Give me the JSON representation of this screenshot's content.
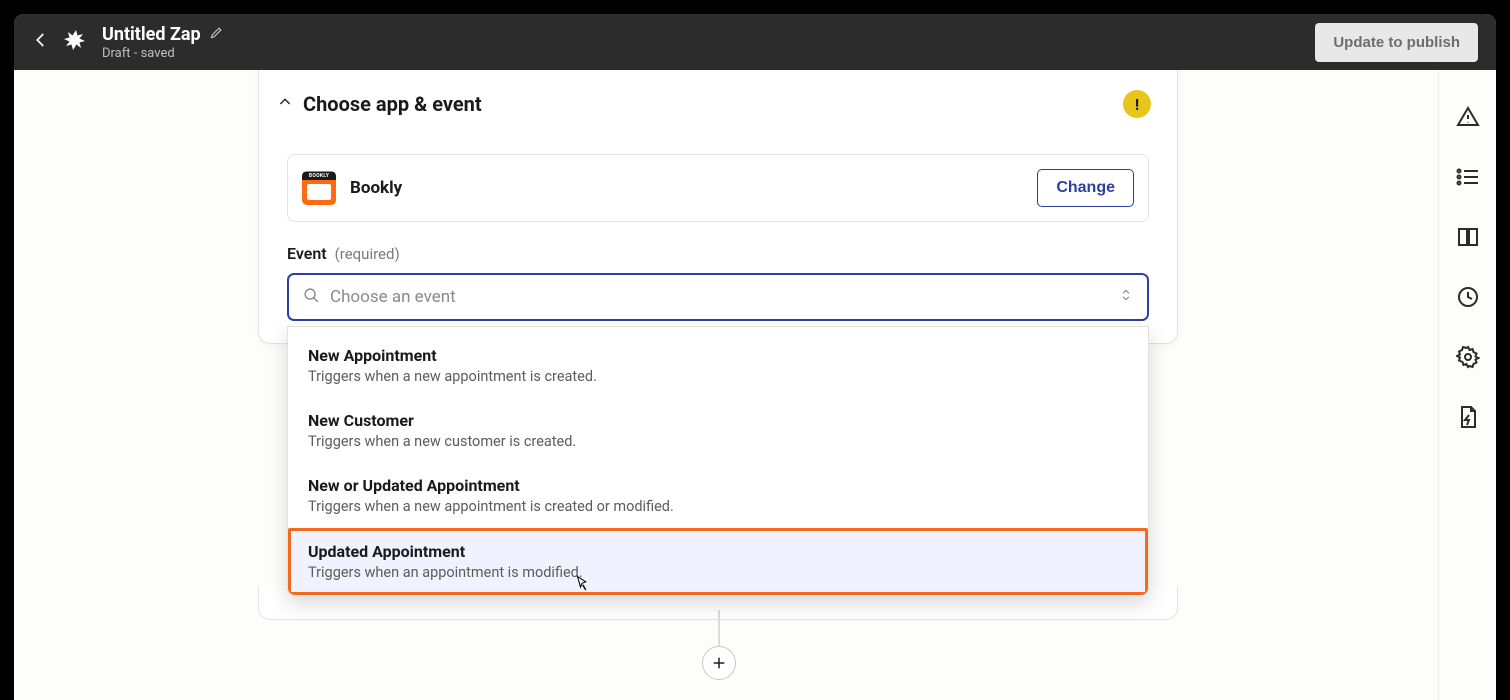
{
  "header": {
    "title": "Untitled Zap",
    "status": "Draft - saved",
    "publish_label": "Update to publish"
  },
  "section": {
    "title": "Choose app & event",
    "warn": "!"
  },
  "app": {
    "name": "Bookly",
    "change_label": "Change"
  },
  "event_field": {
    "label": "Event",
    "required": "(required)",
    "placeholder": "Choose an event"
  },
  "options": [
    {
      "title": "New Appointment",
      "desc": "Triggers when a new appointment is created."
    },
    {
      "title": "New Customer",
      "desc": "Triggers when a new customer is created."
    },
    {
      "title": "New or Updated Appointment",
      "desc": "Triggers when a new appointment is created or modified."
    },
    {
      "title": "Updated Appointment",
      "desc": "Triggers when an appointment is modified."
    }
  ]
}
